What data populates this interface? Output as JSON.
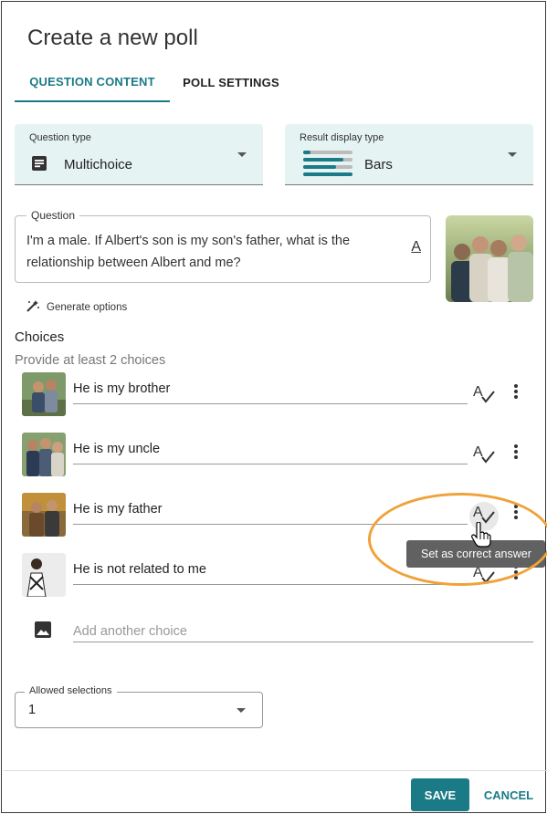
{
  "dialog": {
    "title": "Create a new poll"
  },
  "tabs": [
    {
      "label": "QUESTION CONTENT",
      "active": true
    },
    {
      "label": "POLL SETTINGS",
      "active": false
    }
  ],
  "question_type": {
    "label": "Question type",
    "value": "Multichoice",
    "icon": "document-list-icon"
  },
  "result_display": {
    "label": "Result display type",
    "value": "Bars",
    "icon": "bars-chart-icon"
  },
  "question": {
    "label": "Question",
    "text": "I'm a male. If Albert's son is my son's father, what is the relationship between Albert and me?",
    "format_icon": "text-format-icon"
  },
  "generate_options": {
    "label": "Generate options",
    "icon": "magic-wand-icon"
  },
  "choices": {
    "heading": "Choices",
    "subtitle": "Provide at least 2 choices",
    "items": [
      {
        "text": "He is my brother"
      },
      {
        "text": "He is my uncle"
      },
      {
        "text": "He is my father"
      },
      {
        "text": "He is not related to me"
      }
    ],
    "add_placeholder": "Add another choice"
  },
  "tooltip": {
    "text": "Set as correct answer"
  },
  "allowed_selections": {
    "label": "Allowed selections",
    "value": "1"
  },
  "footer": {
    "save": "SAVE",
    "cancel": "CANCEL"
  },
  "colors": {
    "accent": "#1a7a86",
    "select_bg": "#e6f3f3",
    "highlight": "#f0a23a",
    "tooltip_bg": "#616161"
  }
}
